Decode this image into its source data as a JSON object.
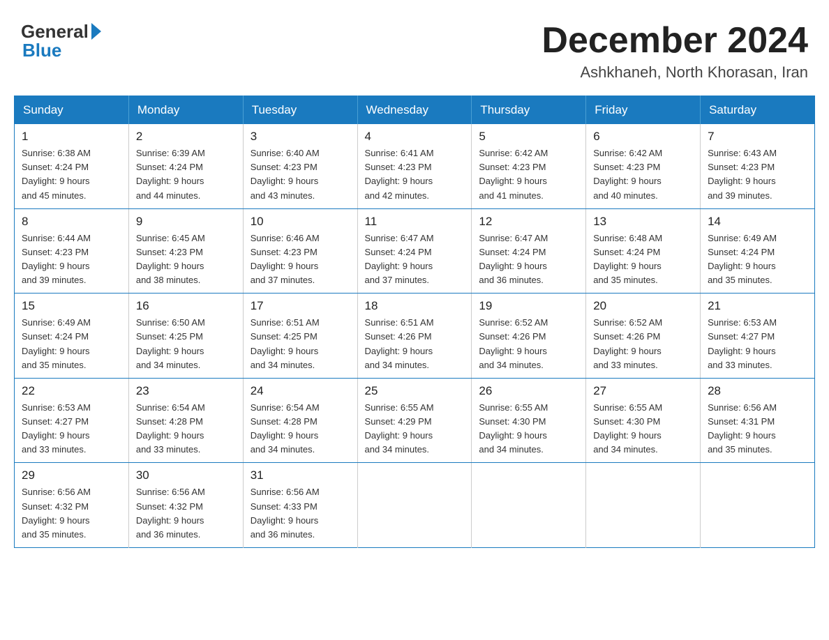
{
  "header": {
    "logo_general": "General",
    "logo_blue": "Blue",
    "month_title": "December 2024",
    "location": "Ashkhaneh, North Khorasan, Iran"
  },
  "days_of_week": [
    "Sunday",
    "Monday",
    "Tuesday",
    "Wednesday",
    "Thursday",
    "Friday",
    "Saturday"
  ],
  "weeks": [
    [
      {
        "day": "1",
        "sunrise": "6:38 AM",
        "sunset": "4:24 PM",
        "daylight": "9 hours and 45 minutes."
      },
      {
        "day": "2",
        "sunrise": "6:39 AM",
        "sunset": "4:24 PM",
        "daylight": "9 hours and 44 minutes."
      },
      {
        "day": "3",
        "sunrise": "6:40 AM",
        "sunset": "4:23 PM",
        "daylight": "9 hours and 43 minutes."
      },
      {
        "day": "4",
        "sunrise": "6:41 AM",
        "sunset": "4:23 PM",
        "daylight": "9 hours and 42 minutes."
      },
      {
        "day": "5",
        "sunrise": "6:42 AM",
        "sunset": "4:23 PM",
        "daylight": "9 hours and 41 minutes."
      },
      {
        "day": "6",
        "sunrise": "6:42 AM",
        "sunset": "4:23 PM",
        "daylight": "9 hours and 40 minutes."
      },
      {
        "day": "7",
        "sunrise": "6:43 AM",
        "sunset": "4:23 PM",
        "daylight": "9 hours and 39 minutes."
      }
    ],
    [
      {
        "day": "8",
        "sunrise": "6:44 AM",
        "sunset": "4:23 PM",
        "daylight": "9 hours and 39 minutes."
      },
      {
        "day": "9",
        "sunrise": "6:45 AM",
        "sunset": "4:23 PM",
        "daylight": "9 hours and 38 minutes."
      },
      {
        "day": "10",
        "sunrise": "6:46 AM",
        "sunset": "4:23 PM",
        "daylight": "9 hours and 37 minutes."
      },
      {
        "day": "11",
        "sunrise": "6:47 AM",
        "sunset": "4:24 PM",
        "daylight": "9 hours and 37 minutes."
      },
      {
        "day": "12",
        "sunrise": "6:47 AM",
        "sunset": "4:24 PM",
        "daylight": "9 hours and 36 minutes."
      },
      {
        "day": "13",
        "sunrise": "6:48 AM",
        "sunset": "4:24 PM",
        "daylight": "9 hours and 35 minutes."
      },
      {
        "day": "14",
        "sunrise": "6:49 AM",
        "sunset": "4:24 PM",
        "daylight": "9 hours and 35 minutes."
      }
    ],
    [
      {
        "day": "15",
        "sunrise": "6:49 AM",
        "sunset": "4:24 PM",
        "daylight": "9 hours and 35 minutes."
      },
      {
        "day": "16",
        "sunrise": "6:50 AM",
        "sunset": "4:25 PM",
        "daylight": "9 hours and 34 minutes."
      },
      {
        "day": "17",
        "sunrise": "6:51 AM",
        "sunset": "4:25 PM",
        "daylight": "9 hours and 34 minutes."
      },
      {
        "day": "18",
        "sunrise": "6:51 AM",
        "sunset": "4:26 PM",
        "daylight": "9 hours and 34 minutes."
      },
      {
        "day": "19",
        "sunrise": "6:52 AM",
        "sunset": "4:26 PM",
        "daylight": "9 hours and 34 minutes."
      },
      {
        "day": "20",
        "sunrise": "6:52 AM",
        "sunset": "4:26 PM",
        "daylight": "9 hours and 33 minutes."
      },
      {
        "day": "21",
        "sunrise": "6:53 AM",
        "sunset": "4:27 PM",
        "daylight": "9 hours and 33 minutes."
      }
    ],
    [
      {
        "day": "22",
        "sunrise": "6:53 AM",
        "sunset": "4:27 PM",
        "daylight": "9 hours and 33 minutes."
      },
      {
        "day": "23",
        "sunrise": "6:54 AM",
        "sunset": "4:28 PM",
        "daylight": "9 hours and 33 minutes."
      },
      {
        "day": "24",
        "sunrise": "6:54 AM",
        "sunset": "4:28 PM",
        "daylight": "9 hours and 34 minutes."
      },
      {
        "day": "25",
        "sunrise": "6:55 AM",
        "sunset": "4:29 PM",
        "daylight": "9 hours and 34 minutes."
      },
      {
        "day": "26",
        "sunrise": "6:55 AM",
        "sunset": "4:30 PM",
        "daylight": "9 hours and 34 minutes."
      },
      {
        "day": "27",
        "sunrise": "6:55 AM",
        "sunset": "4:30 PM",
        "daylight": "9 hours and 34 minutes."
      },
      {
        "day": "28",
        "sunrise": "6:56 AM",
        "sunset": "4:31 PM",
        "daylight": "9 hours and 35 minutes."
      }
    ],
    [
      {
        "day": "29",
        "sunrise": "6:56 AM",
        "sunset": "4:32 PM",
        "daylight": "9 hours and 35 minutes."
      },
      {
        "day": "30",
        "sunrise": "6:56 AM",
        "sunset": "4:32 PM",
        "daylight": "9 hours and 36 minutes."
      },
      {
        "day": "31",
        "sunrise": "6:56 AM",
        "sunset": "4:33 PM",
        "daylight": "9 hours and 36 minutes."
      },
      null,
      null,
      null,
      null
    ]
  ],
  "labels": {
    "sunrise": "Sunrise:",
    "sunset": "Sunset:",
    "daylight": "Daylight:"
  }
}
